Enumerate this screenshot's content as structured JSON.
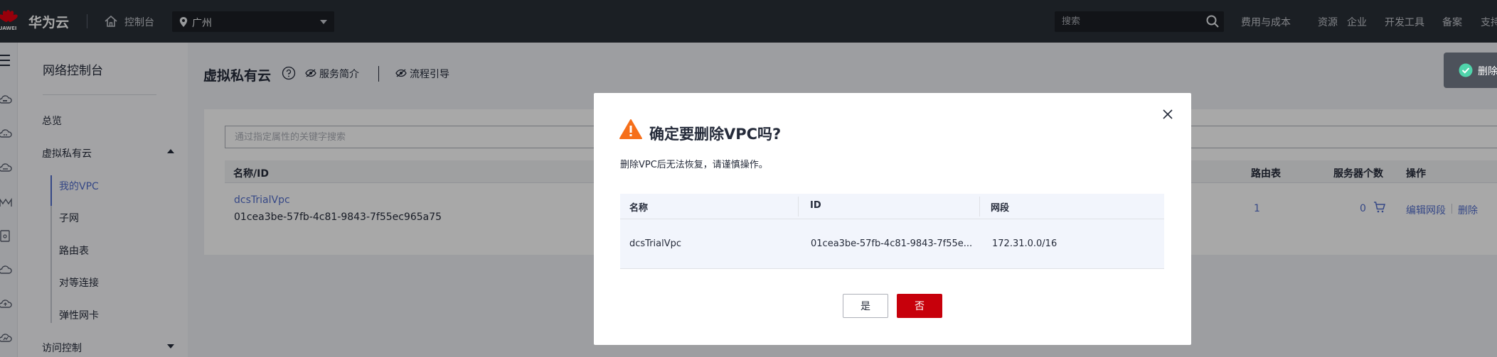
{
  "header": {
    "logo_text": "HUAWEI",
    "brand": "华为云",
    "console_label": "控制台",
    "region": "广州",
    "search_placeholder": "搜索",
    "nav": [
      "费用与成本",
      "资源",
      "企业",
      "开发工具",
      "备案",
      "支持"
    ]
  },
  "sidebar": {
    "title": "网络控制台",
    "overview": "总览",
    "vpc_group": "虚拟私有云",
    "sub_items": [
      "我的VPC",
      "子网",
      "路由表",
      "对等连接",
      "弹性网卡"
    ],
    "access_control": "访问控制"
  },
  "main": {
    "title": "虚拟私有云",
    "service_intro": "服务简介",
    "process_guide": "流程引导",
    "filter_placeholder": "通过指定属性的关键字搜索",
    "table": {
      "headers": {
        "name_id": "名称/ID",
        "route_table": "路由表",
        "server_count": "服务器个数",
        "operation": "操作"
      },
      "rows": [
        {
          "name": "dcsTrialVpc",
          "id": "01cea3be-57fb-4c81-9843-7f55ec965a75",
          "route_table": "1",
          "server_count": "0",
          "edit": "编辑网段",
          "delete": "删除"
        }
      ]
    }
  },
  "toast": {
    "text": "删除"
  },
  "dialog": {
    "title": "确定要删除VPC吗?",
    "description": "删除VPC后无法恢复，请谨慎操作。",
    "table": {
      "headers": {
        "name": "名称",
        "id": "ID",
        "cidr": "网段"
      },
      "row": {
        "name": "dcsTrialVpc",
        "id": "01cea3be-57fb-4c81-9843-7f55e...",
        "cidr": "172.31.0.0/16"
      }
    },
    "yes_label": "是",
    "no_label": "否"
  },
  "colors": {
    "topbar": "#2a2f37",
    "brand_red": "#c7000b",
    "link_blue": "#526ecc",
    "warning": "#f66f1a",
    "success": "#50d4ab"
  }
}
